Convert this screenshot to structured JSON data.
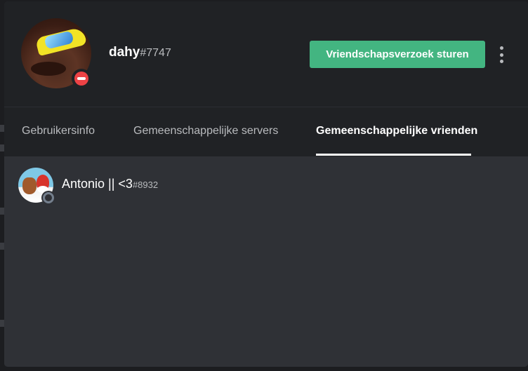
{
  "profile": {
    "username": "dahy",
    "discriminator": "#7747",
    "status": "do-not-disturb",
    "friend_request_label": "Vriendschapsverzoek sturen",
    "more_icon": "more-vertical-icon"
  },
  "tabs": [
    {
      "label": "Gebruikersinfo",
      "active": false
    },
    {
      "label": "Gemeenschappelijke servers",
      "active": false
    },
    {
      "label": "Gemeenschappelijke vrienden",
      "active": true
    }
  ],
  "mutual_friends": [
    {
      "name": "Antonio || <3",
      "discriminator": "#8932",
      "status": "offline"
    }
  ],
  "colors": {
    "accent_green": "#43b581",
    "dnd_red": "#ed4245",
    "offline_gray": "#747f8d",
    "header_bg": "#202225",
    "content_bg": "#2f3136"
  }
}
